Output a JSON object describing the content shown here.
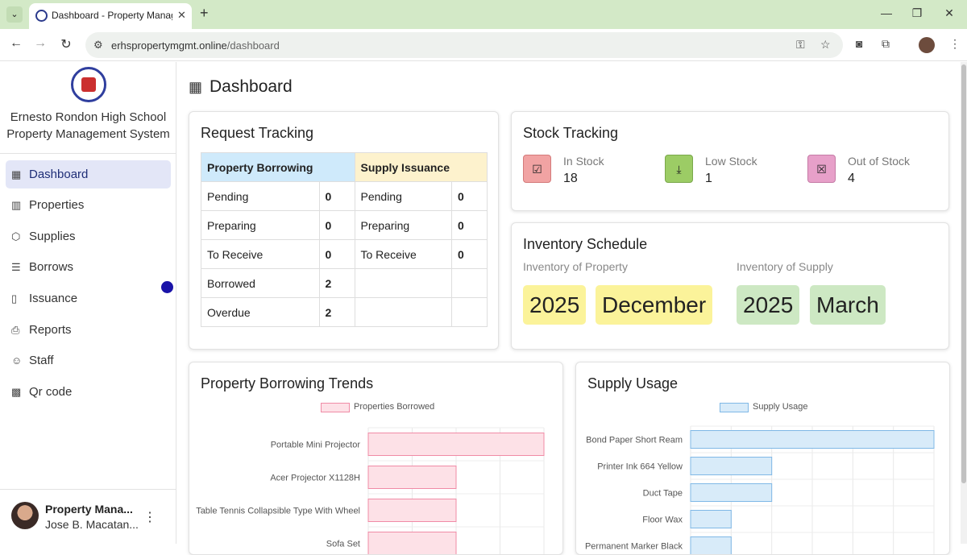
{
  "browser": {
    "tab_title": "Dashboard - Property Manager",
    "url_domain": "erhspropertymgmt.online",
    "url_path": "/dashboard"
  },
  "sidebar": {
    "school_name_line1": "Ernesto Rondon High School",
    "school_name_line2": "Property Management System",
    "items": [
      {
        "label": "Dashboard",
        "icon": "grid-icon"
      },
      {
        "label": "Properties",
        "icon": "building-icon"
      },
      {
        "label": "Supplies",
        "icon": "box-icon"
      },
      {
        "label": "Borrows",
        "icon": "list-icon"
      },
      {
        "label": "Issuance",
        "icon": "document-check-icon"
      },
      {
        "label": "Reports",
        "icon": "printer-icon"
      },
      {
        "label": "Staff",
        "icon": "people-icon"
      },
      {
        "label": "Qr code",
        "icon": "qr-code-icon"
      }
    ],
    "user_role": "Property Mana...",
    "user_name": "Jose B. Macatan..."
  },
  "page_title": "Dashboard",
  "request_tracking": {
    "title": "Request Tracking",
    "property_header": "Property Borrowing",
    "supply_header": "Supply Issuance",
    "property_rows": [
      {
        "label": "Pending",
        "value": "0"
      },
      {
        "label": "Preparing",
        "value": "0"
      },
      {
        "label": "To Receive",
        "value": "0"
      },
      {
        "label": "Borrowed",
        "value": "2"
      },
      {
        "label": "Overdue",
        "value": "2"
      }
    ],
    "supply_rows": [
      {
        "label": "Pending",
        "value": "0"
      },
      {
        "label": "Preparing",
        "value": "0"
      },
      {
        "label": "To Receive",
        "value": "0"
      },
      {
        "label": "",
        "value": ""
      },
      {
        "label": "",
        "value": ""
      }
    ]
  },
  "stock_tracking": {
    "title": "Stock Tracking",
    "items": [
      {
        "label": "In Stock",
        "value": "18",
        "icon": "checkbox-icon",
        "color": "#f1a3a3"
      },
      {
        "label": "Low Stock",
        "value": "1",
        "icon": "download-box-icon",
        "color": "#9ccc65"
      },
      {
        "label": "Out of Stock",
        "value": "4",
        "icon": "x-box-icon",
        "color": "#e7a0c9"
      }
    ]
  },
  "inventory_schedule": {
    "title": "Inventory Schedule",
    "property_label": "Inventory of Property",
    "property_year": "2025",
    "property_month": "December",
    "supply_label": "Inventory of Supply",
    "supply_year": "2025",
    "supply_month": "March"
  },
  "chart_data": [
    {
      "type": "bar",
      "orientation": "horizontal",
      "title": "Property Borrowing Trends",
      "categories": [
        "Portable Mini Projector",
        "Acer Projector X1128H",
        "Table Tennis Collapsible Type With Wheel",
        "Sofa Set"
      ],
      "series": [
        {
          "name": "Properties Borrowed",
          "values": [
            4,
            2,
            2,
            2
          ]
        }
      ],
      "xlim": [
        0,
        4
      ],
      "grid": true,
      "legend": "top",
      "colors": {
        "fill": "#fde1e7",
        "stroke": "#f08ba6"
      }
    },
    {
      "type": "bar",
      "orientation": "horizontal",
      "title": "Supply Usage",
      "categories": [
        "Bond Paper Short Ream",
        "Printer Ink 664 Yellow",
        "Duct Tape",
        "Floor Wax",
        "Permanent Marker Black"
      ],
      "series": [
        {
          "name": "Supply Usage",
          "values": [
            6,
            2,
            2,
            1,
            1
          ]
        }
      ],
      "xlim": [
        0,
        6
      ],
      "grid": true,
      "legend": "top",
      "colors": {
        "fill": "#d8ebf9",
        "stroke": "#7fb8e6"
      }
    }
  ]
}
